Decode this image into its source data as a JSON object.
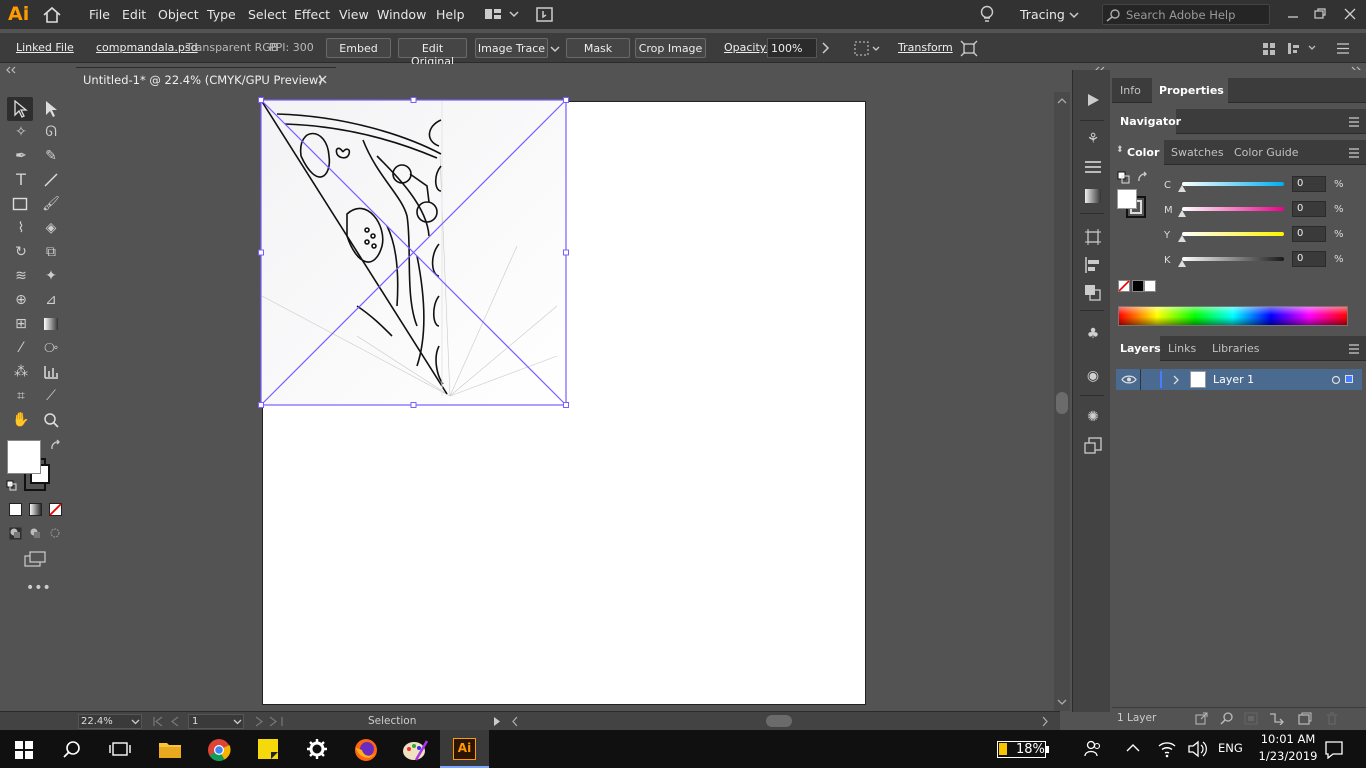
{
  "app": {
    "logo": "Ai"
  },
  "menu": [
    "File",
    "Edit",
    "Object",
    "Type",
    "Select",
    "Effect",
    "View",
    "Window",
    "Help"
  ],
  "workspace": "Tracing",
  "search": {
    "placeholder": "Search Adobe Help"
  },
  "control": {
    "linked_file": "Linked File",
    "filename": "compmandala.psd",
    "colorspace": "Transparent RGB",
    "ppi": "PPI: 300",
    "embed": "Embed",
    "edit_original": "Edit Original",
    "image_trace": "Image Trace",
    "mask": "Mask",
    "crop_image": "Crop Image",
    "opacity_label": "Opacity:",
    "opacity_value": "100%",
    "transform": "Transform"
  },
  "document": {
    "tab_title": "Untitled-1* @ 22.4% (CMYK/GPU Preview)"
  },
  "status": {
    "zoom": "22.4%",
    "page": "1",
    "tool": "Selection"
  },
  "panels": {
    "top_tabs": [
      "Info",
      "Properties"
    ],
    "navigator": "Navigator",
    "color_tabs": [
      "Color",
      "Swatches",
      "Color Guide"
    ],
    "cmyk": [
      {
        "label": "C",
        "value": "0",
        "unit": "%",
        "color": "#00aeef",
        "fill": 0
      },
      {
        "label": "M",
        "value": "0",
        "unit": "%",
        "color": "#ec008c",
        "fill": 0
      },
      {
        "label": "Y",
        "value": "0",
        "unit": "%",
        "color": "#fff200",
        "fill": 0
      },
      {
        "label": "K",
        "value": "0",
        "unit": "%",
        "color": "#1a1a1a",
        "fill": 0
      }
    ],
    "layer_tabs": [
      "Layers",
      "Links",
      "Libraries"
    ],
    "layers": [
      {
        "name": "Layer 1"
      }
    ],
    "layer_count": "1 Layer"
  },
  "taskbar": {
    "battery": "18%",
    "language": "ENG",
    "time": "10:01 AM",
    "date": "1/23/2019"
  },
  "colors": {
    "selection": "#7b5cff",
    "accent": "#ff9a00",
    "layer_row": "#4b6a8f"
  }
}
